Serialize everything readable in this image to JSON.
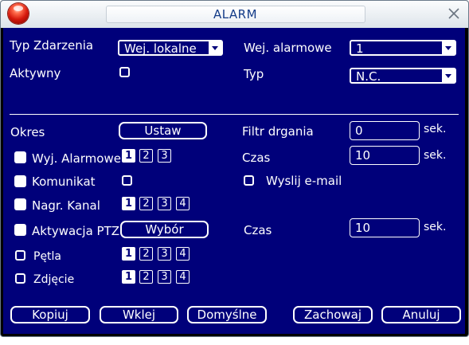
{
  "dialog": {
    "title": "ALARM",
    "close_icon": "close-icon",
    "orb_icon": "alarm-orb-icon"
  },
  "event": {
    "type_label": "Typ Zdarzenia",
    "type_value": "Wej. lokalne",
    "active_label": "Aktywny",
    "alarm_input_label": "Wej. alarmowe",
    "alarm_input_value": "1",
    "input_type_label": "Typ",
    "input_type_value": "N.C."
  },
  "period": {
    "label": "Okres",
    "set_button": "Ustaw",
    "debounce_label": "Filtr drgania",
    "debounce_value": "0",
    "debounce_unit": "sek."
  },
  "alarm_output": {
    "label": "Wyj. Alarmowe",
    "channels": [
      "1",
      "2",
      "3"
    ],
    "selected": [
      1
    ],
    "time_label": "Czas",
    "time_value": "10",
    "time_unit": "sek."
  },
  "message": {
    "label": "Komunikat",
    "email_label": "Wyslij e-mail"
  },
  "record_channel": {
    "label": "Nagr. Kanal",
    "channels": [
      "1",
      "2",
      "3",
      "4"
    ],
    "selected": [
      1
    ]
  },
  "ptz": {
    "label": "Aktywacja PTZ",
    "select_button": "Wybór",
    "time_label": "Czas",
    "time_value": "10",
    "time_unit": "sek."
  },
  "tour": {
    "label": "Pętla",
    "channels": [
      "1",
      "2",
      "3",
      "4"
    ],
    "selected": [
      1
    ]
  },
  "snapshot": {
    "label": "Zdjęcie",
    "channels": [
      "1",
      "2",
      "3",
      "4"
    ],
    "selected": [
      1
    ]
  },
  "footer": {
    "copy": "Kopiuj",
    "paste": "Wklej",
    "default": "Domyślne",
    "save": "Zachowaj",
    "cancel": "Anuluj"
  },
  "colors": {
    "panel_bg": "#00007a",
    "text": "#ffffff",
    "title_text": "#143c88"
  }
}
